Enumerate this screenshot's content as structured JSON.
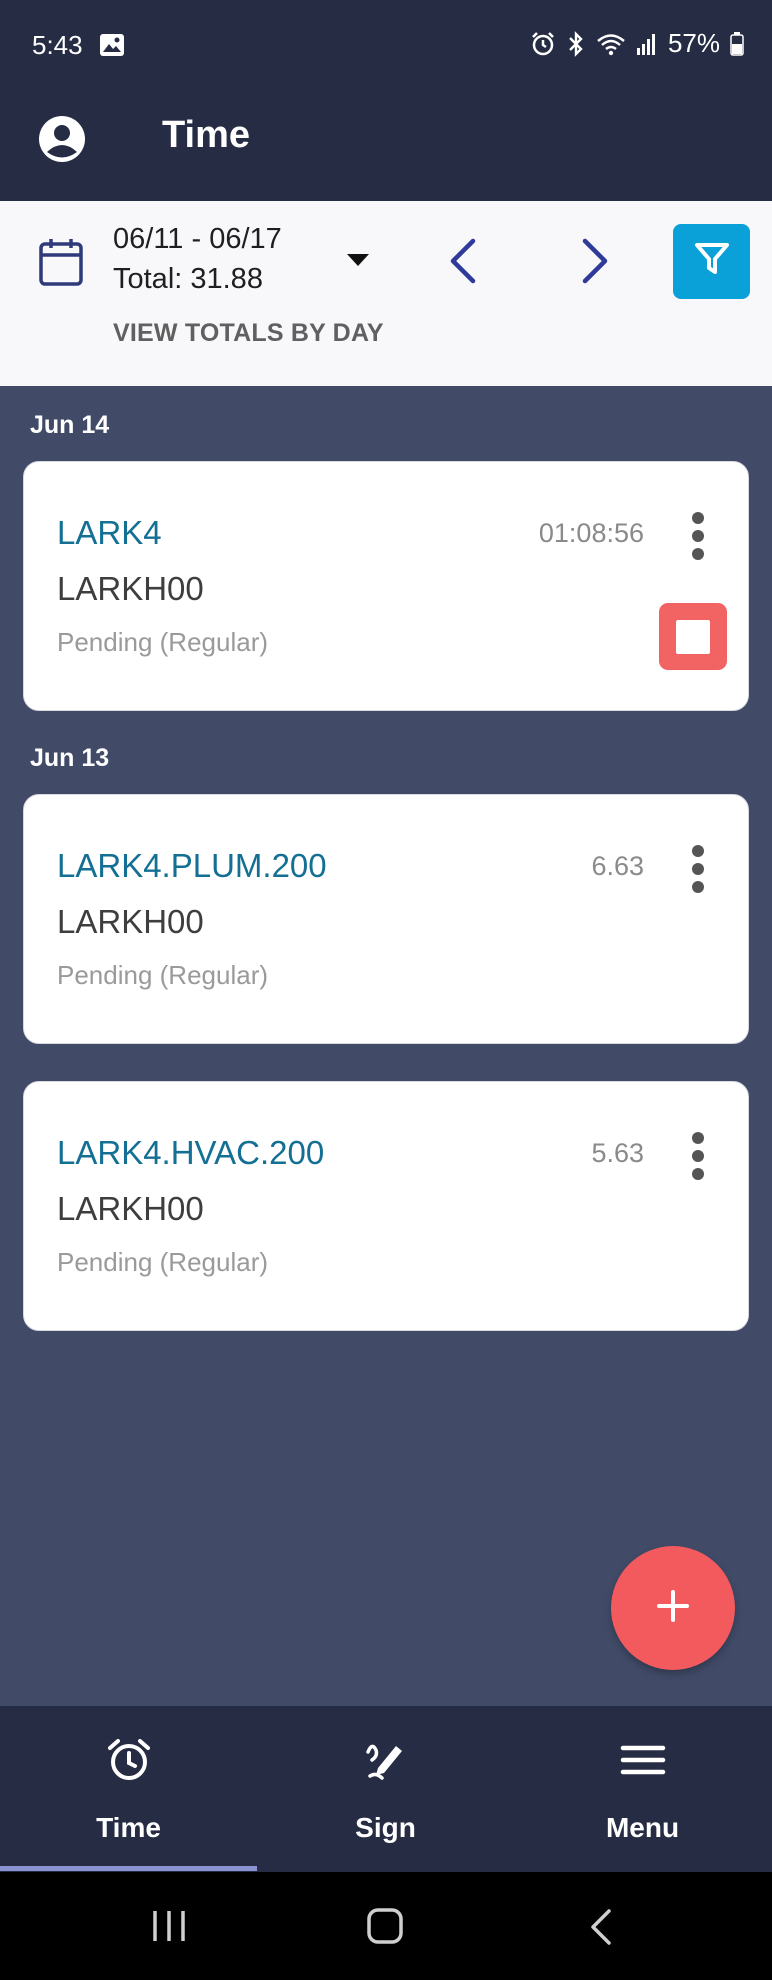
{
  "status_bar": {
    "time": "5:43",
    "battery_percent": "57%",
    "icons": [
      "image-icon",
      "alarm-icon",
      "bluetooth-icon",
      "wifi-icon",
      "signal-icon",
      "battery-icon"
    ]
  },
  "header": {
    "title": "Time",
    "avatar_icon": "account-circle-icon"
  },
  "range": {
    "dates": "06/11 - 06/17",
    "total": "Total: 31.88",
    "view_totals_label": "VIEW TOTALS BY DAY"
  },
  "groups": [
    {
      "date": "Jun 14",
      "entries": [
        {
          "code": "LARK4",
          "employee": "LARKH00",
          "status": "Pending (Regular)",
          "hours": "01:08:56",
          "running": true
        }
      ]
    },
    {
      "date": "Jun 13",
      "entries": [
        {
          "code": "LARK4.PLUM.200",
          "employee": "LARKH00",
          "status": "Pending (Regular)",
          "hours": "6.63",
          "running": false
        },
        {
          "code": "LARK4.HVAC.200",
          "employee": "LARKH00",
          "status": "Pending (Regular)",
          "hours": "5.63",
          "running": false
        }
      ]
    }
  ],
  "fab": {
    "icon": "plus-icon"
  },
  "bottom_nav": [
    {
      "label": "Time",
      "icon": "alarm-clock-icon",
      "active": true
    },
    {
      "label": "Sign",
      "icon": "signature-icon",
      "active": false
    },
    {
      "label": "Menu",
      "icon": "hamburger-menu-icon",
      "active": false
    }
  ],
  "colors": {
    "header_bg": "#262c43",
    "content_bg": "#414b68",
    "accent_blue": "#0aa0d8",
    "code_text": "#136f93",
    "stop_red": "#f26363",
    "fab_red": "#f25a5d",
    "nav_indicator": "#8a93d2"
  }
}
